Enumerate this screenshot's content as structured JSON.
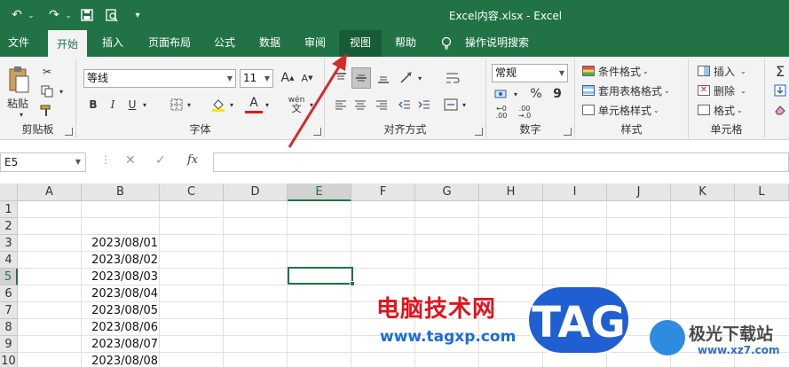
{
  "titlebar": {
    "title": "Excel内容.xlsx  -  Excel",
    "quick_access": [
      "undo-icon",
      "redo-icon",
      "save-icon",
      "print-preview-icon",
      "customize-icon"
    ]
  },
  "tabs": [
    "文件",
    "开始",
    "插入",
    "页面布局",
    "公式",
    "数据",
    "审阅",
    "视图",
    "帮助",
    "操作说明搜索"
  ],
  "active_tab": "开始",
  "ribbon": {
    "clipboard": {
      "label": "剪贴板",
      "paste": "粘贴"
    },
    "font": {
      "label": "字体",
      "font_name": "等线",
      "font_size": "11",
      "bold": "B",
      "italic": "I",
      "underline": "U",
      "font_color_a": "A",
      "grow": "A",
      "shrink": "A",
      "wen": "wén"
    },
    "alignment": {
      "label": "对齐方式"
    },
    "number": {
      "label": "数字",
      "format": "常规",
      "percent": "%",
      "comma": "9"
    },
    "styles": {
      "label": "样式",
      "conditional": "条件格式",
      "table": "套用表格格式",
      "cell_style": "单元格样式"
    },
    "cells": {
      "label": "单元格",
      "insert": "插入",
      "delete": "删除",
      "format": "格式"
    }
  },
  "formula_bar": {
    "name_box": "E5",
    "fx": "fx",
    "cancel": "✕",
    "enter": "✓",
    "value": ""
  },
  "columns": [
    "A",
    "B",
    "C",
    "D",
    "E",
    "F",
    "G",
    "H",
    "I",
    "J",
    "K",
    "L"
  ],
  "rows": [
    "1",
    "2",
    "3",
    "4",
    "5",
    "6",
    "7",
    "8",
    "9",
    "10"
  ],
  "selected_cell": "E5",
  "cells": {
    "B3": "2023/08/01",
    "B4": "2023/08/02",
    "B5": "2023/08/03",
    "B6": "2023/08/04",
    "B7": "2023/08/05",
    "B8": "2023/08/06",
    "B9": "2023/08/07",
    "B10": "2023/08/08"
  },
  "watermark": {
    "brand": "电脑技术网",
    "url": "www.tagxp.com",
    "tag": "TAG",
    "logo_text": "极光下载站",
    "logo_url": "www.xz7.com"
  },
  "colors": {
    "excel_green": "#217346",
    "annotation_red": "#d42a2a"
  }
}
